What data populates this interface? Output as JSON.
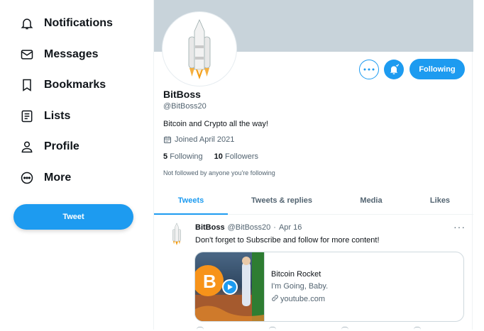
{
  "sidebar": {
    "items": [
      {
        "label": "Notifications",
        "icon": "bell-icon"
      },
      {
        "label": "Messages",
        "icon": "envelope-icon"
      },
      {
        "label": "Bookmarks",
        "icon": "bookmark-icon"
      },
      {
        "label": "Lists",
        "icon": "list-icon"
      },
      {
        "label": "Profile",
        "icon": "person-icon"
      },
      {
        "label": "More",
        "icon": "more-circle-icon"
      }
    ],
    "tweet_button": "Tweet"
  },
  "profile": {
    "display_name": "BitBoss",
    "handle": "@BitBoss20",
    "bio": "Bitcoin and Crypto all the way!",
    "joined": "Joined April 2021",
    "following_count": "5",
    "following_label": "Following",
    "followers_count": "10",
    "followers_label": "Followers",
    "not_followed": "Not followed by anyone you're following",
    "following_button": "Following"
  },
  "tabs": [
    {
      "label": "Tweets",
      "active": true
    },
    {
      "label": "Tweets & replies",
      "active": false
    },
    {
      "label": "Media",
      "active": false
    },
    {
      "label": "Likes",
      "active": false
    }
  ],
  "tweet": {
    "name": "BitBoss",
    "handle": "@BitBoss20",
    "separator": "·",
    "date": "Apr 16",
    "text": "Don't forget to Subscribe and follow for more content!",
    "more": "···",
    "card": {
      "title": "Bitcoin Rocket",
      "description": "I'm Going, Baby.",
      "link": "youtube.com"
    }
  },
  "colors": {
    "accent": "#1d9bf0",
    "banner": "#c8d3da",
    "text_primary": "#0f1419",
    "text_secondary": "#536471"
  }
}
